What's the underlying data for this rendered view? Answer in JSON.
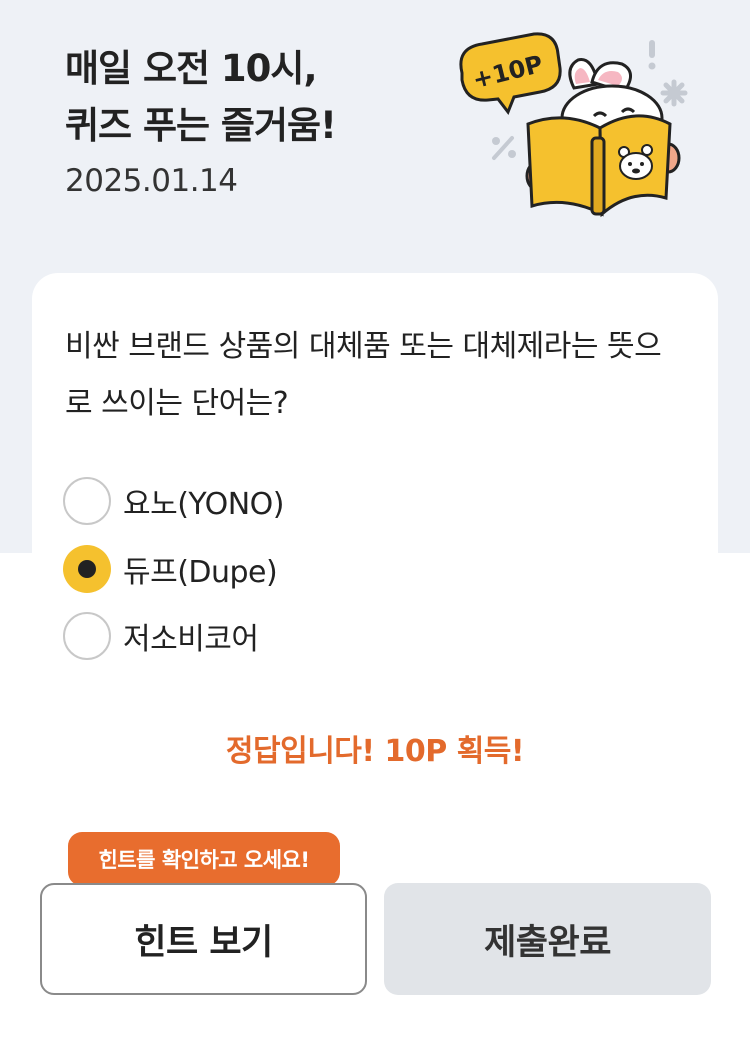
{
  "header": {
    "headline_line1": "매일 오전 10시,",
    "headline_line2": "퀴즈 푸는 즐거움!",
    "date": "2025.01.14",
    "illustration_badge": "+10P"
  },
  "quiz": {
    "question": "비싼 브랜드 상품의 대체품 또는 대체제라는 뜻으로 쓰이는 단어는?",
    "options": [
      {
        "label": "요노(YONO)",
        "selected": false
      },
      {
        "label": "듀프(Dupe)",
        "selected": true
      },
      {
        "label": "저소비코어",
        "selected": false
      }
    ],
    "result_message": "정답입니다! 10P 획득!"
  },
  "actions": {
    "hint_tooltip": "힌트를 확인하고 오세요!",
    "hint_button": "힌트 보기",
    "submit_button": "제출완료"
  },
  "colors": {
    "accent_yellow": "#f5c12e",
    "result_orange": "#e36a2c",
    "tooltip_orange": "#e86d2e",
    "header_bg": "#eef1f6"
  }
}
